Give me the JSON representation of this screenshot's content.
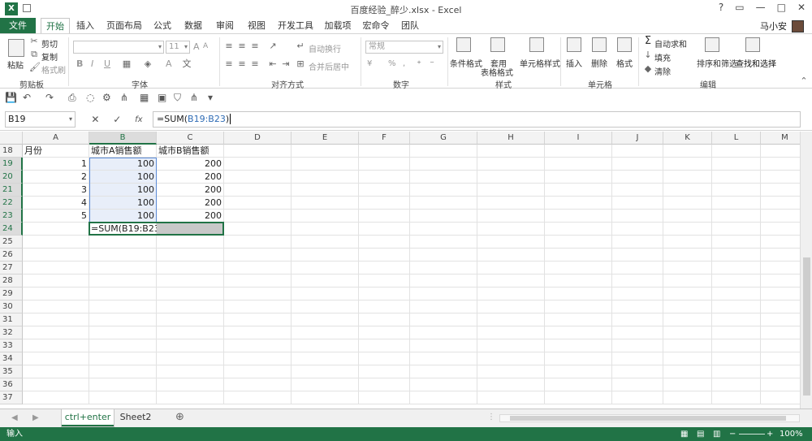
{
  "window": {
    "title": "百度经验_醉少.xlsx - Excel",
    "help": "?",
    "ribbon_toggle": "▭",
    "minimize": "—",
    "maximize": "□",
    "close": "✕"
  },
  "tabs": [
    "文件",
    "开始",
    "插入",
    "页面布局",
    "公式",
    "数据",
    "审阅",
    "视图",
    "开发工具",
    "加载项",
    "宏命令",
    "团队"
  ],
  "user": {
    "name": "马小安"
  },
  "ribbon": {
    "clipboard": {
      "paste": "粘贴",
      "cut": "剪切",
      "copy": "复制",
      "format_painter": "格式刷",
      "label": "剪贴板"
    },
    "font": {
      "font_size": "11",
      "label": "字体",
      "bold": "B",
      "italic": "I",
      "underline": "U",
      "grow": "A",
      "shrink": "A",
      "color_a": "A"
    },
    "alignment": {
      "wrap": "自动换行",
      "merge": "合并后居中",
      "label": "对齐方式"
    },
    "number": {
      "format": "常规",
      "label": "数字",
      "currency": "¥",
      "percent": "%",
      "comma": ","
    },
    "styles": {
      "conditional": "条件格式",
      "table_format_1": "套用",
      "table_format_2": "表格格式",
      "cell_styles": "单元格样式",
      "label": "样式"
    },
    "cells": {
      "insert": "插入",
      "delete": "删除",
      "format": "格式",
      "label": "单元格"
    },
    "editing": {
      "autosum": "自动求和",
      "fill": "填充",
      "clear": "清除",
      "sort_filter": "排序和筛选",
      "find_select": "查找和选择",
      "label": "编辑"
    }
  },
  "formula_bar": {
    "name_box": "B19",
    "fx": "fx",
    "formula_prefix": "=SUM(",
    "formula_ref": "B19:B23",
    "formula_suffix": ")"
  },
  "columns": [
    "A",
    "B",
    "C",
    "D",
    "E",
    "F",
    "G",
    "H",
    "I",
    "J",
    "K",
    "L",
    "M"
  ],
  "rows": [
    "18",
    "19",
    "20",
    "21",
    "22",
    "23",
    "24",
    "25",
    "26",
    "27",
    "28",
    "29",
    "30",
    "31",
    "32",
    "33",
    "34",
    "35",
    "36",
    "37"
  ],
  "cells": {
    "A18": "月份",
    "B18": "城市A销售额",
    "C18": "城市B销售额",
    "A19": "1",
    "B19": "100",
    "C19": "200",
    "A20": "2",
    "B20": "100",
    "C20": "200",
    "A21": "3",
    "B21": "100",
    "C21": "200",
    "A22": "4",
    "B22": "100",
    "C22": "200",
    "A23": "5",
    "B23": "100",
    "C23": "200",
    "B24": "=SUM(B19:B23)"
  },
  "sheets": [
    "ctrl+enter",
    "Sheet2"
  ],
  "status": {
    "mode": "输入",
    "zoom": "100%"
  },
  "colors": {
    "accent": "#217346",
    "ref_blue": "#2f6cb5"
  }
}
